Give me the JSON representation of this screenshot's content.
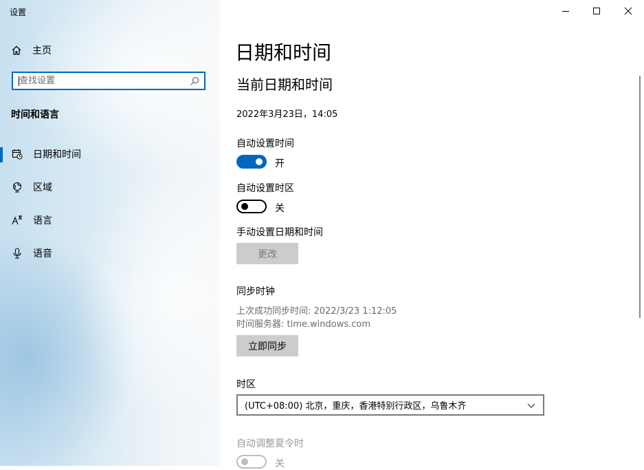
{
  "window": {
    "title": "设置"
  },
  "sidebar": {
    "home_label": "主页",
    "search_placeholder": "查找设置",
    "section_title": "时间和语言",
    "items": [
      {
        "label": "日期和时间",
        "icon": "calendar-clock-icon",
        "active": true
      },
      {
        "label": "区域",
        "icon": "globe-icon",
        "active": false
      },
      {
        "label": "语言",
        "icon": "language-icon",
        "active": false
      },
      {
        "label": "语音",
        "icon": "microphone-icon",
        "active": false
      }
    ]
  },
  "titlebar": {
    "buttons": [
      "minimize-icon",
      "maximize-icon",
      "close-icon"
    ]
  },
  "main": {
    "page_title": "日期和时间",
    "current_heading": "当前日期和时间",
    "current_datetime": "2022年3月23日，14:05",
    "auto_time_label": "自动设置时间",
    "auto_time_state": "开",
    "auto_tz_label": "自动设置时区",
    "auto_tz_state": "关",
    "manual_label": "手动设置日期和时间",
    "change_button": "更改",
    "sync_heading": "同步时钟",
    "last_sync": "上次成功同步时间: 2022/3/23 1:12:05",
    "time_server": "时间服务器: time.windows.com",
    "sync_button": "立即同步",
    "timezone_label": "时区",
    "timezone_value": "(UTC+08:00) 北京，重庆，香港特别行政区，乌鲁木齐",
    "dst_label": "自动调整夏令时",
    "dst_state": "关"
  },
  "colors": {
    "accent": "#0067c0",
    "button_bg": "#cccccc",
    "disabled_text": "#7a7a7a"
  }
}
